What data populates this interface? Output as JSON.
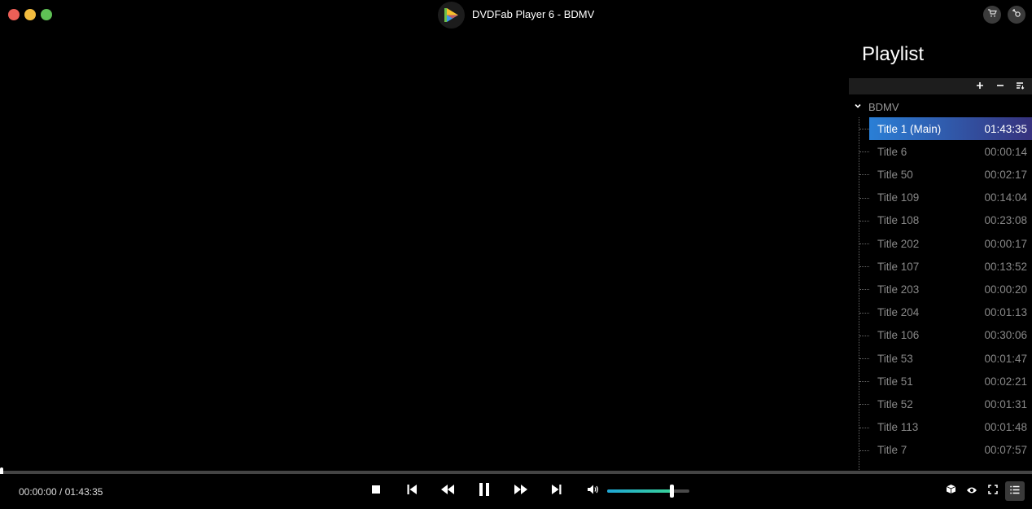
{
  "window": {
    "title": "DVDFab Player 6 - BDMV",
    "accent_colors": {
      "close": "#ec5f57",
      "minimize": "#f4bd3f",
      "maximize": "#5fc155"
    },
    "buttons": {
      "cart": "cart-icon",
      "key": "key-icon"
    }
  },
  "playlist": {
    "heading": "Playlist",
    "tools": {
      "add": "plus-icon",
      "remove": "minus-icon",
      "sort": "sort-list-icon"
    },
    "group": "BDMV",
    "items": [
      {
        "title": "Title 1 (Main)",
        "duration": "01:43:35",
        "active": true
      },
      {
        "title": "Title 6",
        "duration": "00:00:14"
      },
      {
        "title": "Title 50",
        "duration": "00:02:17"
      },
      {
        "title": "Title 109",
        "duration": "00:14:04"
      },
      {
        "title": "Title 108",
        "duration": "00:23:08"
      },
      {
        "title": "Title 202",
        "duration": "00:00:17"
      },
      {
        "title": "Title 107",
        "duration": "00:13:52"
      },
      {
        "title": "Title 203",
        "duration": "00:00:20"
      },
      {
        "title": "Title 204",
        "duration": "00:01:13"
      },
      {
        "title": "Title 106",
        "duration": "00:30:06"
      },
      {
        "title": "Title 53",
        "duration": "00:01:47"
      },
      {
        "title": "Title 51",
        "duration": "00:02:21"
      },
      {
        "title": "Title 52",
        "duration": "00:01:31"
      },
      {
        "title": "Title 113",
        "duration": "00:01:48"
      },
      {
        "title": "Title 7",
        "duration": "00:07:57"
      }
    ]
  },
  "playback": {
    "time_display": "00:00:00 / 01:43:35",
    "progress": 0.0,
    "volume": 0.78
  },
  "controls": {
    "stop": "stop-icon",
    "previous": "skip-previous-icon",
    "rewind": "rewind-icon",
    "pause": "pause-icon",
    "forward": "fast-forward-icon",
    "next": "skip-next-icon",
    "volume": "volume-icon",
    "right_tools": [
      "3d-box-icon",
      "eye-icon",
      "fullscreen-icon",
      "playlist-toggle-icon"
    ]
  }
}
